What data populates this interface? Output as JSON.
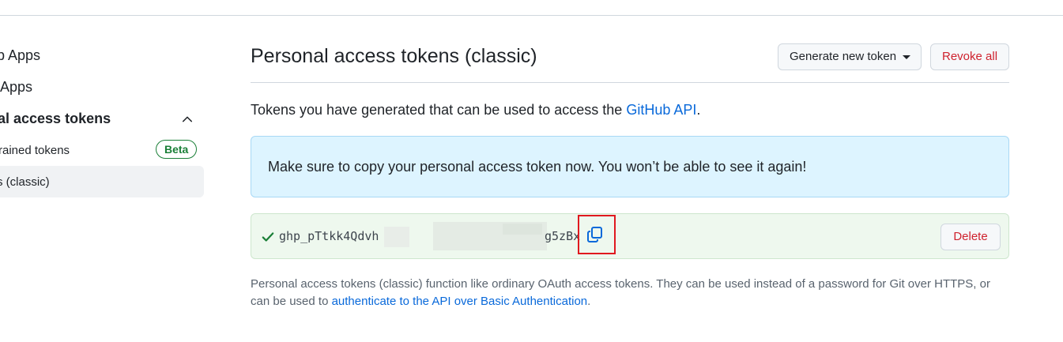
{
  "sidebar": {
    "items": [
      {
        "label": "ub Apps"
      },
      {
        "label": "n Apps"
      },
      {
        "label": "nal access tokens"
      },
      {
        "label": "rained tokens",
        "badge": "Beta"
      },
      {
        "label": "s (classic)"
      }
    ]
  },
  "header": {
    "title": "Personal access tokens (classic)",
    "generate_label": "Generate new token",
    "revoke_label": "Revoke all"
  },
  "intro": {
    "text": "Tokens you have generated that can be used to access the ",
    "link": "GitHub API",
    "suffix": "."
  },
  "flash": {
    "message": "Make sure to copy your personal access token now. You won’t be able to see it again!"
  },
  "token": {
    "prefix": "ghp_pTtkk4Qdvh",
    "suffix": "g5zBx",
    "delete_label": "Delete"
  },
  "note": {
    "text": "Personal access tokens (classic) function like ordinary OAuth access tokens. They can be used instead of a password for Git over HTTPS, or can be used to ",
    "link": "authenticate to the API over Basic Authentication",
    "suffix": "."
  },
  "colors": {
    "accent": "#0969da",
    "danger": "#cf222e",
    "success": "#1a7f37",
    "flash_bg": "#ddf4ff",
    "token_bg": "#eef8ee",
    "highlight": "#e0191f"
  }
}
